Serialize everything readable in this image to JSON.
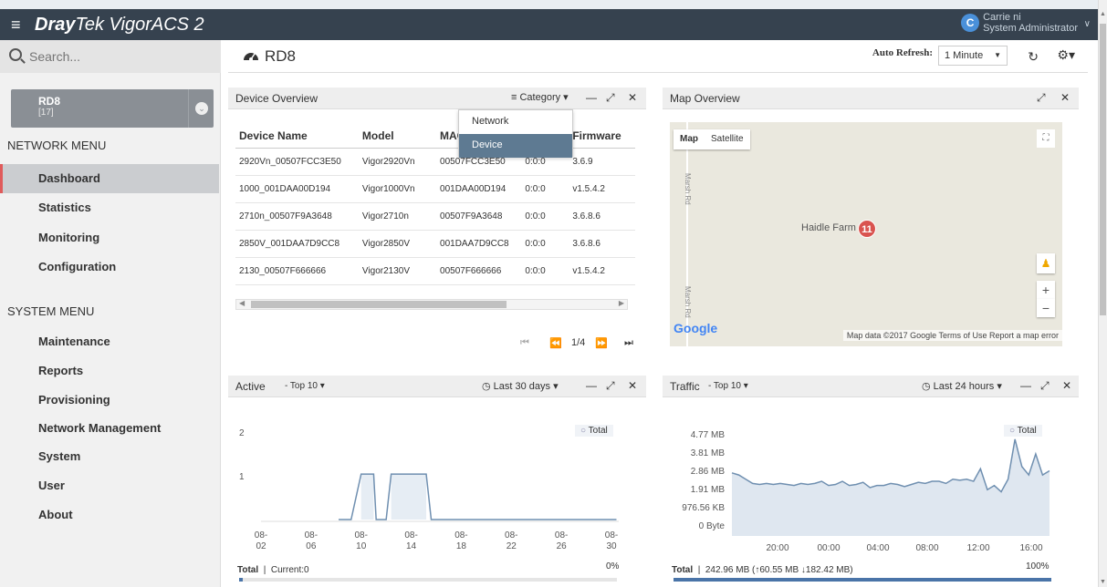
{
  "app": {
    "brand_bold": "Dray",
    "brand_rest": "Tek VigorACS 2"
  },
  "user": {
    "initial": "C",
    "name": "Carrie ni",
    "role": "System Administrator"
  },
  "search": {
    "placeholder": "Search..."
  },
  "device_selector": {
    "name": "RD8",
    "count": "[17]"
  },
  "network_menu": {
    "heading": "NETWORK MENU",
    "items": [
      "Dashboard",
      "Statistics",
      "Monitoring",
      "Configuration"
    ],
    "active": "Dashboard"
  },
  "system_menu": {
    "heading": "SYSTEM MENU",
    "items": [
      "Maintenance",
      "Reports",
      "Provisioning",
      "Network Management",
      "System",
      "User",
      "About"
    ]
  },
  "header": {
    "title": "RD8",
    "auto_refresh_label": "Auto Refresh:",
    "auto_refresh_value": "1 Minute"
  },
  "device_overview": {
    "title": "Device Overview",
    "category_label": "Category",
    "category_options": [
      "Network",
      "Device"
    ],
    "category_selected": "Device",
    "columns": [
      "Device Name",
      "Model",
      "MAC",
      "",
      "Firmware"
    ],
    "rows": [
      [
        "2920Vn_00507FCC3E50",
        "Vigor2920Vn",
        "00507FCC3E50",
        "0:0:0",
        "3.6.9"
      ],
      [
        "1000_001DAA00D194",
        "Vigor1000Vn",
        "001DAA00D194",
        "0:0:0",
        "v1.5.4.2"
      ],
      [
        "2710n_00507F9A3648",
        "Vigor2710n",
        "00507F9A3648",
        "0:0:0",
        "3.6.8.6"
      ],
      [
        "2850V_001DAA7D9CC8",
        "Vigor2850V",
        "001DAA7D9CC8",
        "0:0:0",
        "3.6.8.6"
      ],
      [
        "2130_00507F666666",
        "Vigor2130V",
        "00507F666666",
        "0:0:0",
        "v1.5.4.2"
      ]
    ],
    "page": "1/4"
  },
  "map_overview": {
    "title": "Map Overview",
    "map_btn": "Map",
    "satellite_btn": "Satellite",
    "road_label": "Marsh Rd",
    "place": "Haidle Farm",
    "marker_count": "11",
    "google": "Google",
    "attribution": "Map data ©2017 Google   Terms of Use   Report a map error"
  },
  "active_widget": {
    "title": "Active",
    "top_label": "- Top 10",
    "range_label": "Last 30 days",
    "legend": "Total",
    "footer_total_label": "Total",
    "footer_current": "Current:0",
    "percent": "0%",
    "progress": 0.01
  },
  "traffic_widget": {
    "title": "Traffic",
    "top_label": "- Top 10",
    "range_label": "Last 24 hours",
    "legend": "Total",
    "footer_total_label": "Total",
    "footer_detail": "242.96 MB (↑60.55 MB ↓182.42 MB)",
    "percent": "100%",
    "progress": 1.0
  },
  "chart_data": [
    {
      "type": "line",
      "title": "Active",
      "x": [
        "08-02",
        "08-06",
        "08-10",
        "08-14",
        "08-18",
        "08-22",
        "08-26",
        "08-30"
      ],
      "yticks": [
        "2",
        "1"
      ],
      "ylim": [
        0,
        2
      ],
      "series": [
        {
          "name": "Total",
          "points": [
            [
              0,
              0
            ],
            [
              0.2,
              0
            ],
            [
              0.3,
              0
            ],
            [
              0.35,
              1
            ],
            [
              0.4,
              1
            ],
            [
              0.42,
              0
            ],
            [
              0.45,
              0
            ],
            [
              0.5,
              1
            ],
            [
              0.55,
              1
            ],
            [
              0.6,
              1
            ],
            [
              0.65,
              1
            ],
            [
              0.7,
              1
            ],
            [
              0.72,
              0
            ],
            [
              0.8,
              0
            ],
            [
              1.0,
              0
            ],
            [
              1.5,
              0
            ],
            [
              2.0,
              0
            ],
            [
              3.0,
              0
            ],
            [
              4.0,
              0
            ],
            [
              5.0,
              0
            ],
            [
              6.0,
              0
            ],
            [
              7.0,
              0
            ],
            [
              7.2,
              0
            ]
          ]
        }
      ],
      "x_data_points": [
        {
          "x": 1.55,
          "y": 0
        },
        {
          "x": 1.8,
          "y": 0
        },
        {
          "x": 2.0,
          "y": 1
        },
        {
          "x": 2.25,
          "y": 1
        },
        {
          "x": 2.3,
          "y": 0
        },
        {
          "x": 2.5,
          "y": 0
        },
        {
          "x": 2.6,
          "y": 1
        },
        {
          "x": 3.3,
          "y": 1
        },
        {
          "x": 3.4,
          "y": 0
        },
        {
          "x": 7.1,
          "y": 0
        }
      ],
      "legend": "top-right"
    },
    {
      "type": "area",
      "title": "Traffic",
      "x": [
        "20:00",
        "00:00",
        "04:00",
        "08:00",
        "12:00",
        "16:00"
      ],
      "yticks": [
        "4.77 MB",
        "3.81 MB",
        "2.86 MB",
        "1.91 MB",
        "976.56 KB",
        "0 Byte"
      ],
      "ylim": [
        0,
        4.77
      ],
      "series": [
        {
          "name": "Total",
          "values": [
            3.0,
            2.9,
            2.7,
            2.5,
            2.45,
            2.5,
            2.45,
            2.5,
            2.45,
            2.4,
            2.5,
            2.45,
            2.5,
            2.6,
            2.4,
            2.45,
            2.6,
            2.4,
            2.45,
            2.55,
            2.3,
            2.4,
            2.4,
            2.5,
            2.45,
            2.35,
            2.45,
            2.55,
            2.5,
            2.6,
            2.6,
            2.5,
            2.7,
            2.65,
            2.7,
            2.6,
            3.2,
            2.2,
            2.4,
            2.1,
            2.7,
            4.6,
            3.3,
            2.9,
            3.9,
            2.9,
            3.1
          ]
        }
      ],
      "legend": "top-right"
    }
  ]
}
